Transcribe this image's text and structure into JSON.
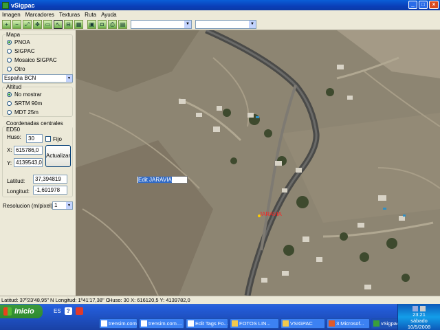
{
  "window": {
    "title": "vSigpac"
  },
  "menu": [
    "Imagen",
    "Marcadores",
    "Texturas",
    "Ruta",
    "Ayuda"
  ],
  "toolbar": {
    "icons": [
      "zoom-in-icon",
      "zoom-out-icon",
      "zoom-extent-icon",
      "pan-icon",
      "select-icon",
      "pointer-icon",
      "measure-icon",
      "grid-icon",
      "save-icon",
      "photo-icon",
      "print-icon",
      "info-icon"
    ],
    "combo1": "",
    "combo2": ""
  },
  "panel": {
    "mapa": {
      "legend": "Mapa",
      "options": [
        "PNOA",
        "SIGPAC",
        "Mosaico SIGPAC",
        "Otro"
      ],
      "selected": "PNOA",
      "select_value": "España BCN"
    },
    "altitud": {
      "legend": "Altitud",
      "options": [
        "No mostrar",
        "SRTM 90m",
        "MDT 25m"
      ],
      "selected": "No mostrar"
    },
    "coords": {
      "legend": "Coordenadas centrales ED50",
      "huso_label": "Huso:",
      "huso_value": "30",
      "fijo_label": "Fijo",
      "x_label": "X:",
      "x_value": "615786,0",
      "y_label": "Y:",
      "y_value": "4139543,0",
      "update_button": "Actualizar",
      "lat_label": "Latitud:",
      "lat_value": "37,394819",
      "lon_label": "Longitud:",
      "lon_value": "-1,691978"
    },
    "resolution": {
      "label": "Resolucion (m/pixel)",
      "value": "1"
    }
  },
  "map": {
    "edit_label": "Edit JARAVIA",
    "marker_label": "JARAVIA"
  },
  "status": {
    "left": "Latitud: 37º23'48,95\" N Longitud: 1º41'17,38\" O",
    "right": "Huso: 30 X: 616120,5 Y: 4139782,0"
  },
  "taskbar": {
    "start": "Inicio",
    "lang": "ES",
    "tasks": [
      "trensim.com....",
      "trensim.com....",
      "Edit Tags Fo...",
      "FOTOS LIN...",
      "VSIGPAC",
      "3 Microsof...",
      "vSigpac"
    ],
    "active_task": "vSigpac",
    "clock": {
      "time": "23:21",
      "day": "sábado",
      "date": "10/5/2008"
    }
  }
}
